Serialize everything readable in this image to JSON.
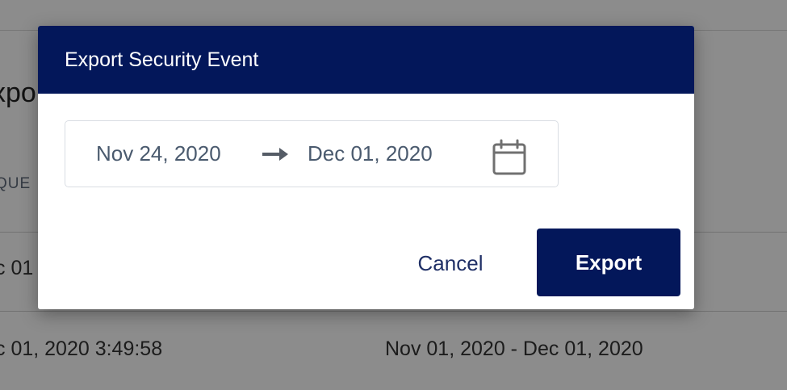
{
  "background": {
    "title_fragment": "xpo",
    "column_header_fragment": "QUE",
    "row1_cell_fragment": "c 01",
    "row2_cell_fragment": "c 01, 2020 3:49:58",
    "row2_range": "Nov 01, 2020 - Dec 01, 2020"
  },
  "modal": {
    "title": "Export Security Event",
    "date_range": {
      "start": "Nov 24, 2020",
      "end": "Dec 01, 2020",
      "separator_icon": "arrow-right-icon",
      "picker_icon": "calendar-icon"
    },
    "cancel_label": "Cancel",
    "export_label": "Export"
  },
  "colors": {
    "primary": "#03175a",
    "overlay": "rgba(0,0,0,0.45)",
    "input_text": "#4a5a6e"
  }
}
